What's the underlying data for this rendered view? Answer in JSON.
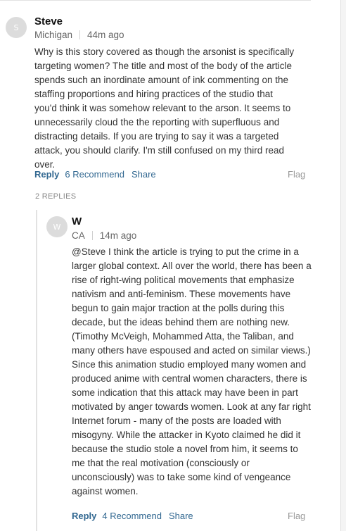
{
  "comment": {
    "avatar_initial": "S",
    "author": "Steve",
    "location": "Michigan",
    "time": "44m ago",
    "body": "Why is this story covered as though the arsonist is specifically targeting women? The title and most of the body of the article spends such an inordinate amount of ink commenting on the staffing proportions and hiring practices of the studio that you'd think it was somehow relevant to the arson. It seems to unnecessarily cloud the the reporting with superfluous and distracting details. If you are trying to say it was a targeted attack, you should clarify. I'm still confused on my third read over.",
    "reply_label": "Reply",
    "recommend_label": "6 Recommend",
    "share_label": "Share",
    "flag_label": "Flag"
  },
  "replies_count": "2 REPLIES",
  "reply": {
    "avatar_initial": "W",
    "author": "W",
    "location": "CA",
    "time": "14m ago",
    "body": "@Steve I think the article is trying to put the crime in a larger global context.  All over the world, there has been a rise of right-wing political movements that emphasize nativism and anti-feminism.  These movements have begun to gain major traction at the polls during this decade, but the ideas behind them are nothing new. (Timothy McVeigh, Mohammed Atta, the Taliban, and many others have espoused and acted on similar views.) Since this animation studio employed many women and produced anime with central women characters, there is some indication that this attack may have been in part motivated by anger towards women.  Look at any far right Internet forum - many of the posts are loaded with misogyny.  While the attacker in Kyoto claimed he did it because the studio stole a novel from him, it seems to me that the real motivation (consciously or unconsciously) was to take some kind of vengeance against women.",
    "reply_label": "Reply",
    "recommend_label": "4 Recommend",
    "share_label": "Share",
    "flag_label": "Flag"
  }
}
